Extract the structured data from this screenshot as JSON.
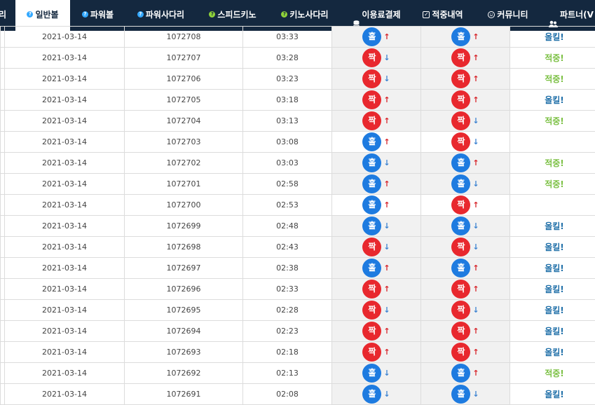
{
  "nav": {
    "tabs": [
      {
        "label": "리",
        "icon": "",
        "active": false
      },
      {
        "label": "일반볼",
        "icon": "question-circle-icon",
        "active": true
      },
      {
        "label": "파워볼",
        "icon": "question-circle-icon",
        "active": false
      },
      {
        "label": "파워사다리",
        "icon": "question-circle-icon",
        "active": false
      },
      {
        "label": "스피드키노",
        "icon": "question-circle-green-icon",
        "active": false
      },
      {
        "label": "키노사다리",
        "icon": "question-circle-green-icon",
        "active": false
      },
      {
        "label": "이용료결제",
        "icon": "database-icon",
        "active": false
      },
      {
        "label": "적중내역",
        "icon": "checkbox-icon",
        "active": false
      },
      {
        "label": "커뮤니티",
        "icon": "smile-icon",
        "active": false
      },
      {
        "label": "파트너(V",
        "icon": "users-icon",
        "active": false
      }
    ]
  },
  "table": {
    "rows": [
      {
        "date": "2021-03-14",
        "round": "1072708",
        "time": "03:33",
        "ball1": "홀",
        "dir1": "up",
        "ball2": "홀",
        "dir2": "up",
        "result": "올킬!"
      },
      {
        "date": "2021-03-14",
        "round": "1072707",
        "time": "03:28",
        "ball1": "짝",
        "dir1": "down",
        "ball2": "짝",
        "dir2": "up",
        "result": "적중!"
      },
      {
        "date": "2021-03-14",
        "round": "1072706",
        "time": "03:23",
        "ball1": "짝",
        "dir1": "down",
        "ball2": "짝",
        "dir2": "up",
        "result": "적중!"
      },
      {
        "date": "2021-03-14",
        "round": "1072705",
        "time": "03:18",
        "ball1": "짝",
        "dir1": "up",
        "ball2": "짝",
        "dir2": "up",
        "result": "올킬!"
      },
      {
        "date": "2021-03-14",
        "round": "1072704",
        "time": "03:13",
        "ball1": "짝",
        "dir1": "up",
        "ball2": "짝",
        "dir2": "down",
        "result": "적중!"
      },
      {
        "date": "2021-03-14",
        "round": "1072703",
        "time": "03:08",
        "ball1": "홀",
        "dir1": "up",
        "ball2": "짝",
        "dir2": "down",
        "result": ""
      },
      {
        "date": "2021-03-14",
        "round": "1072702",
        "time": "03:03",
        "ball1": "홀",
        "dir1": "down",
        "ball2": "홀",
        "dir2": "up",
        "result": "적중!"
      },
      {
        "date": "2021-03-14",
        "round": "1072701",
        "time": "02:58",
        "ball1": "홀",
        "dir1": "up",
        "ball2": "홀",
        "dir2": "down",
        "result": "적중!"
      },
      {
        "date": "2021-03-14",
        "round": "1072700",
        "time": "02:53",
        "ball1": "홀",
        "dir1": "up",
        "ball2": "짝",
        "dir2": "up",
        "result": ""
      },
      {
        "date": "2021-03-14",
        "round": "1072699",
        "time": "02:48",
        "ball1": "홀",
        "dir1": "down",
        "ball2": "홀",
        "dir2": "down",
        "result": "올킬!"
      },
      {
        "date": "2021-03-14",
        "round": "1072698",
        "time": "02:43",
        "ball1": "짝",
        "dir1": "down",
        "ball2": "짝",
        "dir2": "down",
        "result": "올킬!"
      },
      {
        "date": "2021-03-14",
        "round": "1072697",
        "time": "02:38",
        "ball1": "홀",
        "dir1": "up",
        "ball2": "홀",
        "dir2": "up",
        "result": "올킬!"
      },
      {
        "date": "2021-03-14",
        "round": "1072696",
        "time": "02:33",
        "ball1": "짝",
        "dir1": "up",
        "ball2": "짝",
        "dir2": "up",
        "result": "올킬!"
      },
      {
        "date": "2021-03-14",
        "round": "1072695",
        "time": "02:28",
        "ball1": "짝",
        "dir1": "down",
        "ball2": "짝",
        "dir2": "down",
        "result": "올킬!"
      },
      {
        "date": "2021-03-14",
        "round": "1072694",
        "time": "02:23",
        "ball1": "짝",
        "dir1": "up",
        "ball2": "짝",
        "dir2": "up",
        "result": "올킬!"
      },
      {
        "date": "2021-03-14",
        "round": "1072693",
        "time": "02:18",
        "ball1": "짝",
        "dir1": "up",
        "ball2": "짝",
        "dir2": "up",
        "result": "올킬!"
      },
      {
        "date": "2021-03-14",
        "round": "1072692",
        "time": "02:13",
        "ball1": "홀",
        "dir1": "down",
        "ball2": "홀",
        "dir2": "up",
        "result": "적중!"
      },
      {
        "date": "2021-03-14",
        "round": "1072691",
        "time": "02:08",
        "ball1": "홀",
        "dir1": "down",
        "ball2": "홀",
        "dir2": "down",
        "result": "올킬!"
      }
    ]
  },
  "colors": {
    "nav_bg": "#14283f",
    "odd_ball": "#1e7be0",
    "even_ball": "#e8282e",
    "arrow_up": "#d7262c",
    "arrow_down": "#3d83d1",
    "allkill_text": "#1f6fa8",
    "hit_text": "#7bc043"
  }
}
